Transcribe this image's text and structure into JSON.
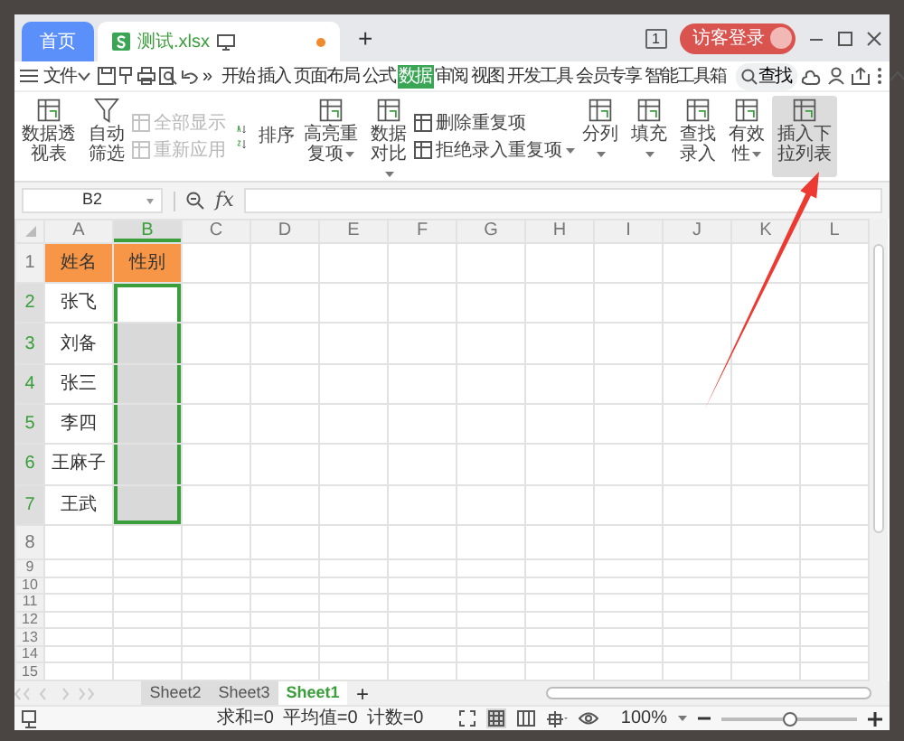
{
  "tab_bar": {
    "tabs": [
      {
        "label": "首页",
        "kind": "home",
        "selected": false
      },
      {
        "label": "测试.xlsx",
        "kind": "file",
        "selected": true,
        "unsaved": true
      }
    ],
    "new_tab": "+",
    "badge": "1",
    "login": "访客登录"
  },
  "menu": {
    "file": "文件",
    "more": "»",
    "search": "查找",
    "tabs": [
      {
        "label": "开始",
        "selected": false
      },
      {
        "label": "插入",
        "selected": false
      },
      {
        "label": "页面布局",
        "selected": false
      },
      {
        "label": "公式",
        "selected": false
      },
      {
        "label": "数据",
        "selected": true
      },
      {
        "label": "审阅",
        "selected": false
      },
      {
        "label": "视图",
        "selected": false
      },
      {
        "label": "开发工具",
        "selected": false
      },
      {
        "label": "会员专享",
        "selected": false
      },
      {
        "label": "智能工具箱",
        "selected": false
      }
    ]
  },
  "ribbon": {
    "items": [
      {
        "kind": "large",
        "label": "数据透视表",
        "dropdown": false,
        "highlighted": false
      },
      {
        "kind": "filter",
        "label": "自动筛选",
        "dropdown": false,
        "highlighted": false
      },
      {
        "kind": "stack",
        "items": [
          {
            "label": "全部显示",
            "disabled": true,
            "dropdown": false
          },
          {
            "label": "重新应用",
            "disabled": true,
            "dropdown": false
          }
        ]
      },
      {
        "kind": "sort",
        "label": "排序",
        "dropdown": false,
        "highlighted": false
      },
      {
        "kind": "large",
        "label": "高亮重复项",
        "dropdown": true,
        "highlighted": false
      },
      {
        "kind": "large",
        "label": "数据对比",
        "dropdown": true,
        "highlighted": false
      },
      {
        "kind": "stack",
        "items": [
          {
            "label": "删除重复项",
            "disabled": false,
            "dropdown": false
          },
          {
            "label": "拒绝录入重复项",
            "disabled": false,
            "dropdown": true
          }
        ]
      },
      {
        "kind": "large",
        "label": "分列",
        "dropdown": true,
        "highlighted": false
      },
      {
        "kind": "large",
        "label": "填充",
        "dropdown": true,
        "highlighted": false
      },
      {
        "kind": "large",
        "label": "查找录入",
        "dropdown": false,
        "highlighted": false
      },
      {
        "kind": "large",
        "label": "有效性",
        "dropdown": true,
        "highlighted": false
      },
      {
        "kind": "large",
        "label": "插入下拉列表",
        "dropdown": false,
        "highlighted": true
      }
    ]
  },
  "formula_bar": {
    "cell_ref": "B2",
    "fx_label": "fx"
  },
  "sheet": {
    "columns": [
      {
        "label": "A",
        "selected": false
      },
      {
        "label": "B",
        "selected": true
      },
      {
        "label": "C",
        "selected": false
      },
      {
        "label": "D",
        "selected": false
      },
      {
        "label": "E",
        "selected": false
      },
      {
        "label": "F",
        "selected": false
      },
      {
        "label": "G",
        "selected": false
      },
      {
        "label": "H",
        "selected": false
      },
      {
        "label": "I",
        "selected": false
      },
      {
        "label": "J",
        "selected": false
      },
      {
        "label": "K",
        "selected": false
      },
      {
        "label": "L",
        "selected": false
      }
    ],
    "rows": [
      {
        "number": "1",
        "kind": "header",
        "selected": false,
        "cells": [
          {
            "text": "姓名",
            "selected": false,
            "active": false
          },
          {
            "text": "性别",
            "selected": false,
            "active": false
          }
        ]
      },
      {
        "number": "2",
        "kind": "data",
        "selected": true,
        "cells": [
          {
            "text": "张飞",
            "selected": false,
            "active": false
          },
          {
            "selected": true,
            "active": true
          }
        ]
      },
      {
        "number": "3",
        "kind": "data",
        "selected": true,
        "cells": [
          {
            "text": "刘备",
            "selected": false,
            "active": false
          },
          {
            "selected": true,
            "active": false
          }
        ]
      },
      {
        "number": "4",
        "kind": "data",
        "selected": true,
        "cells": [
          {
            "text": "张三",
            "selected": false,
            "active": false
          },
          {
            "selected": true,
            "active": false
          }
        ]
      },
      {
        "number": "5",
        "kind": "data",
        "selected": true,
        "cells": [
          {
            "text": "李四",
            "selected": false,
            "active": false
          },
          {
            "selected": true,
            "active": false
          }
        ]
      },
      {
        "number": "6",
        "kind": "data",
        "selected": true,
        "cells": [
          {
            "text": "王麻子",
            "selected": false,
            "active": false
          },
          {
            "selected": true,
            "active": false
          }
        ]
      },
      {
        "number": "7",
        "kind": "data",
        "selected": true,
        "cells": [
          {
            "text": "王武",
            "selected": false,
            "active": false
          },
          {
            "selected": true,
            "active": false
          }
        ]
      },
      {
        "number": "8",
        "kind": "data",
        "selected": false
      },
      {
        "number": "9",
        "kind": "data",
        "selected": false
      },
      {
        "number": "10",
        "kind": "data",
        "selected": false
      },
      {
        "number": "11",
        "kind": "data",
        "selected": false
      },
      {
        "number": "12",
        "kind": "data",
        "selected": false
      },
      {
        "number": "13",
        "kind": "data",
        "selected": false
      },
      {
        "number": "14",
        "kind": "data",
        "selected": false
      },
      {
        "number": "15",
        "kind": "data",
        "selected": false
      }
    ]
  },
  "sheet_tabs": {
    "tabs": [
      {
        "label": "Sheet2",
        "selected": false
      },
      {
        "label": "Sheet3",
        "selected": false
      },
      {
        "label": "Sheet1",
        "selected": true
      }
    ],
    "add": "+"
  },
  "status_bar": {
    "stats": [
      "求和=0",
      "平均值=0",
      "计数=0"
    ],
    "zoom": "100%",
    "zoom_slider": {
      "level": 0.5
    }
  }
}
